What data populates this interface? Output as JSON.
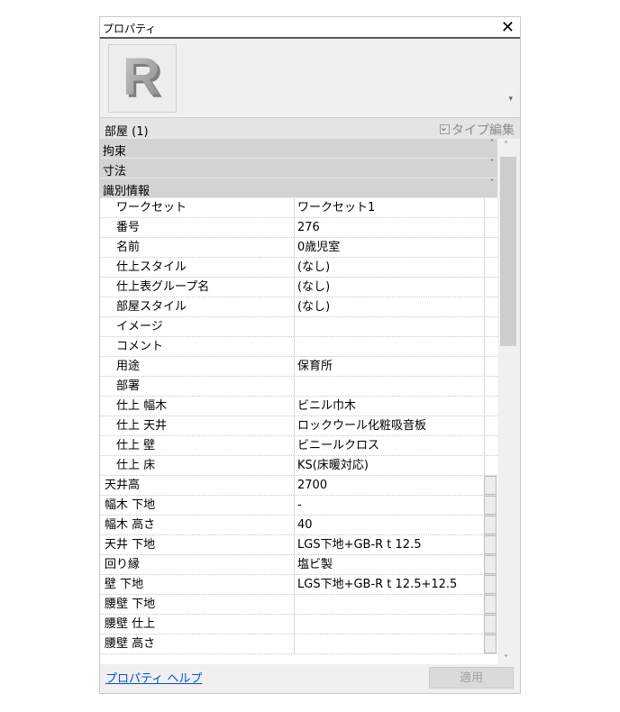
{
  "window": {
    "title": "プロパティ",
    "close_symbol": "✕"
  },
  "preview": {
    "logo_letter": "R",
    "dropdown_symbol": "▾"
  },
  "selector": {
    "label": "部屋 (1)",
    "chevron": "⌄",
    "edit_label": "タイプ編集"
  },
  "groups": {
    "constraints": {
      "label": "拘束",
      "toggle": "˅"
    },
    "dimensions": {
      "label": "寸法",
      "toggle": "˅"
    },
    "identity": {
      "label": "識別情報",
      "toggle": "˄"
    }
  },
  "rows": [
    {
      "name": "ワークセット",
      "value": "ワークセット1"
    },
    {
      "name": "番号",
      "value": "276"
    },
    {
      "name": "名前",
      "value": "0歳児室"
    },
    {
      "name": "仕上スタイル",
      "value": "(なし)"
    },
    {
      "name": "仕上表グループ名",
      "value": "(なし)"
    },
    {
      "name": "部屋スタイル",
      "value": "(なし)"
    },
    {
      "name": "イメージ",
      "value": ""
    },
    {
      "name": "コメント",
      "value": ""
    },
    {
      "name": "用途",
      "value": "保育所"
    },
    {
      "name": "部署",
      "value": ""
    },
    {
      "name": "仕上 幅木",
      "value": "ビニル巾木"
    },
    {
      "name": "仕上 天井",
      "value": "ロックウール化粧吸音板"
    },
    {
      "name": "仕上 壁",
      "value": "ビニールクロス"
    },
    {
      "name": "仕上 床",
      "value": "KS(床暖対応)"
    },
    {
      "name": "天井高",
      "value": "2700"
    },
    {
      "name": "幅木 下地",
      "value": "-"
    },
    {
      "name": "幅木 高さ",
      "value": "40"
    },
    {
      "name": "天井 下地",
      "value": "LGS下地+GB-R t 12.5"
    },
    {
      "name": "回り縁",
      "value": "塩ビ製"
    },
    {
      "name": "壁 下地",
      "value": "LGS下地+GB-R t 12.5+12.5"
    },
    {
      "name": "腰壁 下地",
      "value": ""
    },
    {
      "name": "腰壁 仕上",
      "value": ""
    },
    {
      "name": "腰壁 高さ",
      "value": ""
    }
  ],
  "scrollbar": {
    "up": "˄",
    "down": "˅"
  },
  "footer": {
    "help_link": "プロパティ ヘルプ",
    "apply_label": "適用"
  }
}
